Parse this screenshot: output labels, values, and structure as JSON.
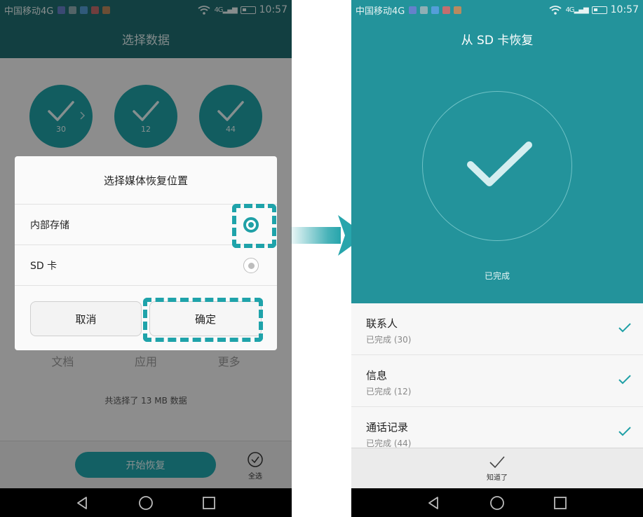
{
  "status_bar": {
    "carrier": "中国移动4G",
    "network": "4G",
    "time": "10:57"
  },
  "left_screen": {
    "title": "选择数据",
    "categories": [
      {
        "count": "30",
        "label": "文档"
      },
      {
        "count": "12",
        "label": "应用"
      },
      {
        "count": "44",
        "label": "更多"
      }
    ],
    "summary": "共选择了 13 MB 数据",
    "start_button": "开始恢复",
    "select_all": "全选",
    "dialog": {
      "title": "选择媒体恢复位置",
      "options": [
        {
          "label": "内部存储",
          "selected": true
        },
        {
          "label": "SD 卡",
          "selected": false
        }
      ],
      "cancel": "取消",
      "confirm": "确定"
    }
  },
  "right_screen": {
    "title": "从 SD 卡恢复",
    "status": "已完成",
    "items": [
      {
        "title": "联系人",
        "subtitle": "已完成 (30)"
      },
      {
        "title": "信息",
        "subtitle": "已完成 (12)"
      },
      {
        "title": "通话记录",
        "subtitle": "已完成 (44)"
      }
    ],
    "got_it": "知道了"
  },
  "colors": {
    "accent": "#1fa0a6",
    "header_dark": "#1f6d70",
    "header_light": "#23939b"
  }
}
